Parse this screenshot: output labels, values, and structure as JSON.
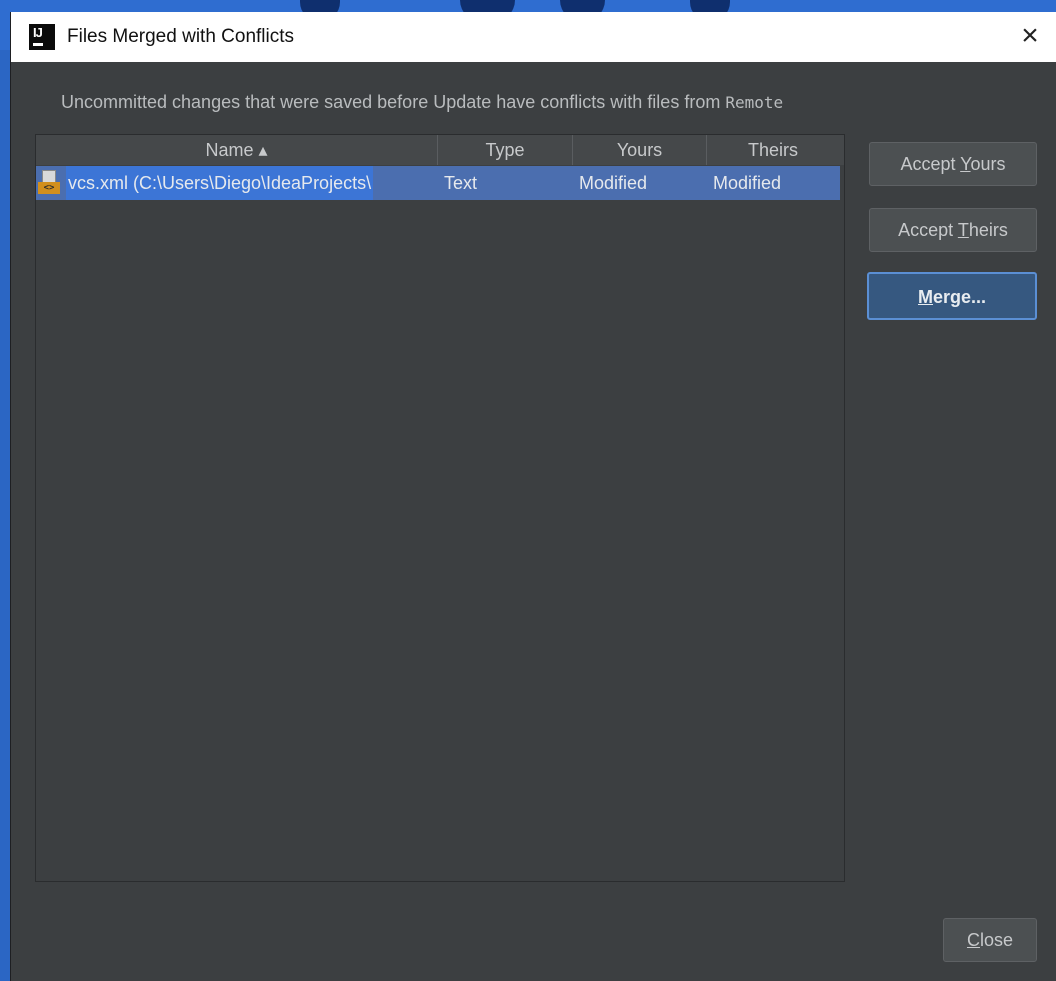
{
  "window": {
    "title": "Files Merged with Conflicts",
    "close_glyph": "×",
    "icon": "intellij-icon"
  },
  "message": {
    "prefix": "Uncommitted changes that were saved before Update have conflicts with files from ",
    "remote": "Remote"
  },
  "table": {
    "columns": {
      "name": "Name ▴",
      "type": "Type",
      "yours": "Yours",
      "theirs": "Theirs"
    },
    "rows": [
      {
        "name": "vcs.xml (C:\\Users\\Diego\\IdeaProjects\\",
        "type": "Text",
        "yours": "Modified",
        "theirs": "Modified",
        "icon": "xml-file-icon"
      }
    ]
  },
  "buttons": {
    "accept_yours_pre": "Accept ",
    "accept_yours_mnemonic": "Y",
    "accept_yours_post": "ours",
    "accept_theirs_pre": "Accept ",
    "accept_theirs_mnemonic": "T",
    "accept_theirs_post": "heirs",
    "merge_mnemonic": "M",
    "merge_post": "erge...",
    "close_mnemonic": "C",
    "close_post": "lose"
  },
  "colors": {
    "dialog_bg": "#3c3f41",
    "selection": "#4b6eaf",
    "background_blue": "#2f6dd0"
  }
}
